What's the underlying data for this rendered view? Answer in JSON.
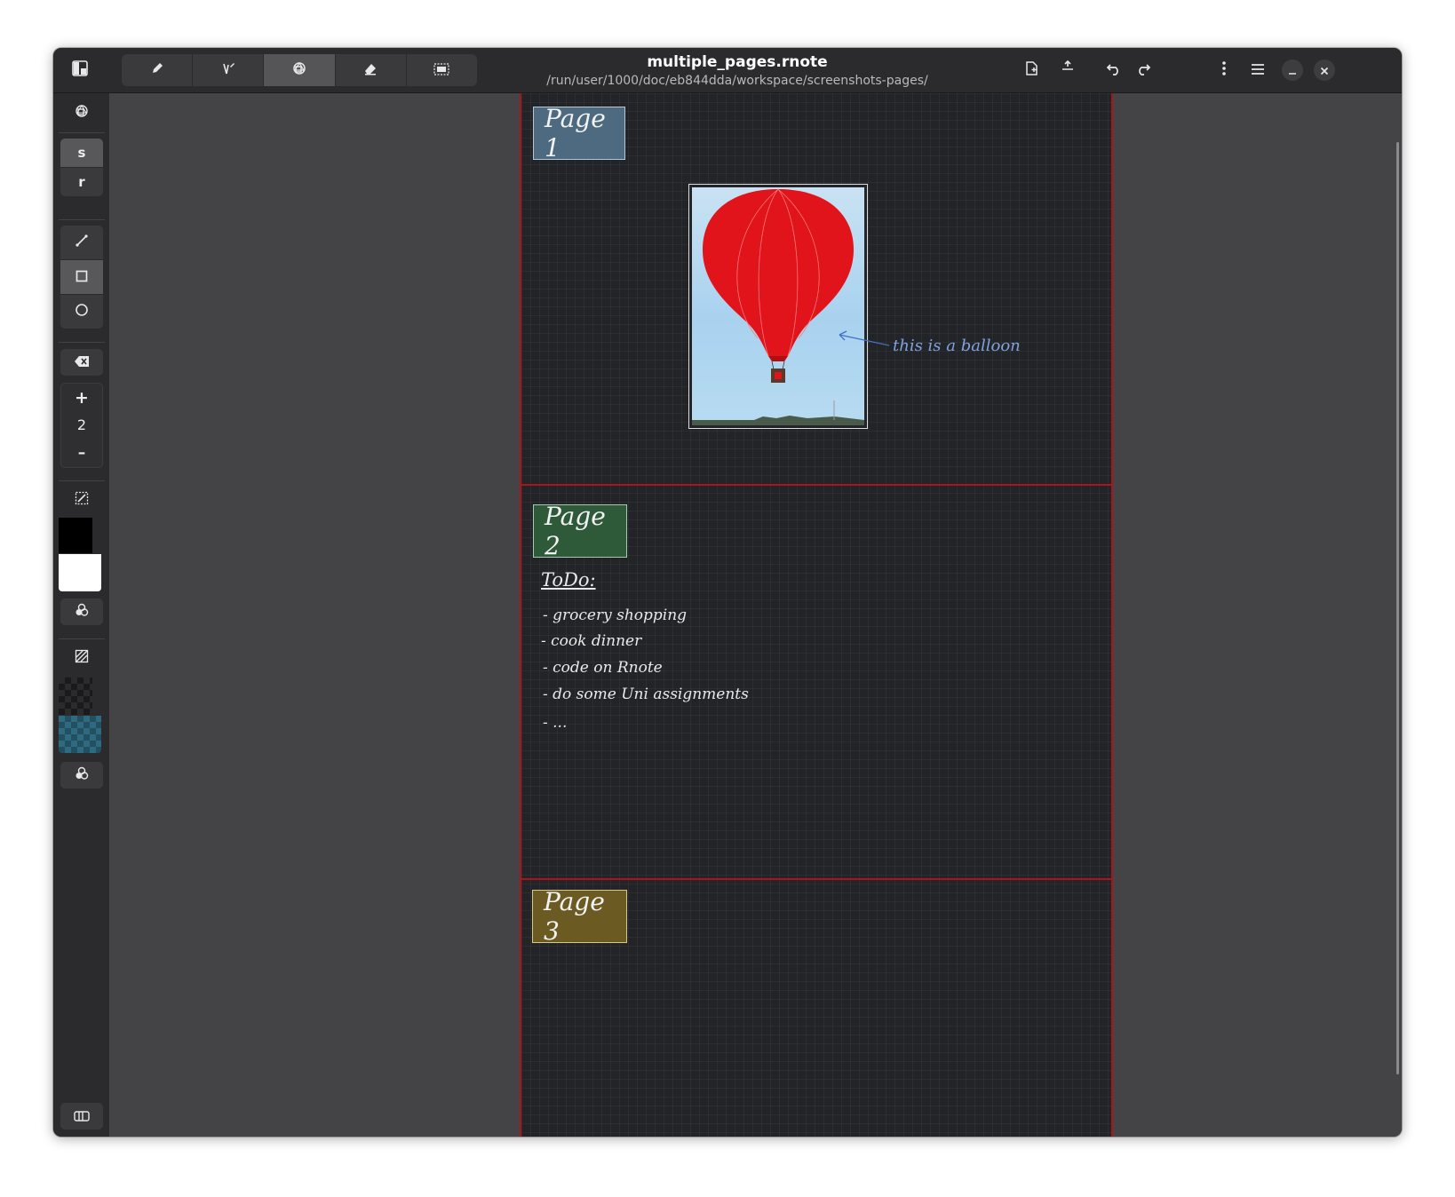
{
  "window": {
    "title": "multiple_pages.rnote",
    "path": "/run/user/1000/doc/eb844dda/workspace/screenshots-pages/"
  },
  "headerbar": {
    "left_icon": "sidebar-toggle-icon",
    "tools": [
      {
        "icon": "pen-icon",
        "active": false
      },
      {
        "icon": "typewriter-icon",
        "active": false
      },
      {
        "icon": "shaper-icon",
        "active": true
      },
      {
        "icon": "eraser-icon",
        "active": false
      },
      {
        "icon": "selector-icon",
        "active": false
      }
    ],
    "right_icons": [
      "export-icon",
      "import-icon",
      "undo-icon",
      "redo-icon",
      "more-vertical-icon",
      "hamburger-menu-icon",
      "minimize-icon",
      "close-icon"
    ]
  },
  "sidebar": {
    "style_icon": "shape-style-icon",
    "style_s": "s",
    "style_r": "r",
    "shape_icons": [
      "line-icon",
      "rectangle-icon",
      "ellipse-icon"
    ],
    "width_reset_icon": "backspace-icon",
    "stroke_width": "2",
    "plus": "+",
    "minus": "–",
    "stroke_color": "#000000",
    "fill_color": "#ffffff",
    "accent_fill_swatch": "#2e6a80",
    "colorpicker_icon": "color-palette-icon",
    "bottom_icon": "panel-toggle-icon"
  },
  "document": {
    "page_border_color": "#a8151b",
    "pages": [
      {
        "label": "Page 1",
        "color": "#4d6a80"
      },
      {
        "label": "Page 2",
        "color": "#2f5a3a"
      },
      {
        "label": "Page 3",
        "color": "#6b5a21"
      }
    ],
    "annotation": "this is a balloon",
    "todo": {
      "title": "ToDo:",
      "items": [
        "- grocery shopping",
        "- cook dinner",
        "- code on Rnote",
        "- do some Uni assignments",
        "- ..."
      ]
    }
  }
}
